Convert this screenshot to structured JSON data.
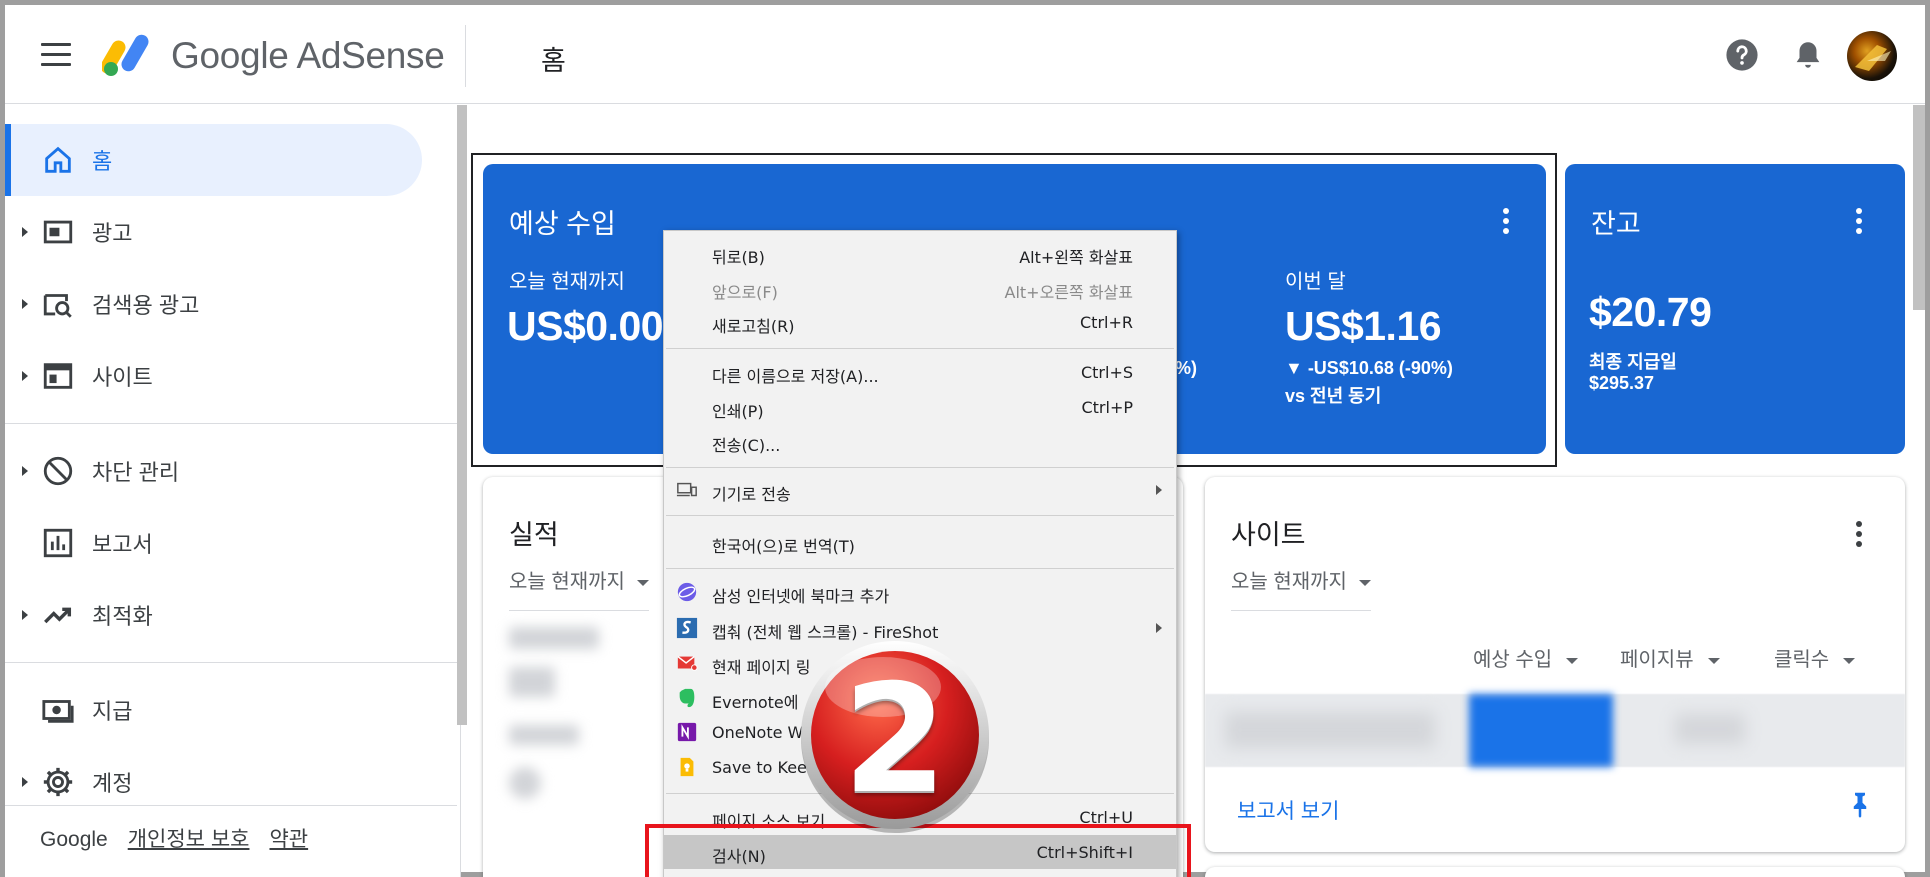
{
  "topbar": {
    "brand": "Google AdSense",
    "page_title": "홈"
  },
  "icons": {
    "menu": "hamburger-menu-icon",
    "help": "help-circle-icon",
    "notifications": "bell-icon",
    "avatar": "user-avatar"
  },
  "sidebar": {
    "items": [
      {
        "label": "홈",
        "icon": "home-icon",
        "active": true
      },
      {
        "label": "광고",
        "icon": "ads-icon"
      },
      {
        "label": "검색용 광고",
        "icon": "search-ads-icon"
      },
      {
        "label": "사이트",
        "icon": "sites-icon"
      },
      {
        "label": "차단 관리",
        "icon": "block-icon"
      },
      {
        "label": "보고서",
        "icon": "reports-icon"
      },
      {
        "label": "최적화",
        "icon": "trending-icon"
      },
      {
        "label": "지급",
        "icon": "payments-icon"
      },
      {
        "label": "계정",
        "icon": "gear-icon"
      }
    ],
    "footer": {
      "brand": "Google",
      "privacy": "개인정보 보호",
      "terms": "약관"
    }
  },
  "earnings_card": {
    "title": "예상 수입",
    "today_label": "오늘 현재까지",
    "today_amount": "US$0.00",
    "partial_pct": "%)",
    "month_label": "이번 달",
    "month_amount": "US$1.16",
    "month_change": "▼ -US$10.68 (-90%)",
    "month_compare": "vs 전년 동기"
  },
  "balance_card": {
    "title": "잔고",
    "amount": "$20.79",
    "last_payment_label": "최종 지급일",
    "last_payment_amount": "$295.37"
  },
  "performance_card": {
    "title": "실적",
    "dropdown": "오늘 현재까지"
  },
  "sites_card": {
    "title": "사이트",
    "dropdown": "오늘 현재까지",
    "columns": [
      "예상 수입",
      "페이지뷰",
      "클릭수"
    ],
    "report_link": "보고서 보기"
  },
  "context_menu": {
    "items": [
      {
        "label": "뒤로(B)",
        "shortcut": "Alt+왼쪽 화살표"
      },
      {
        "label": "앞으로(F)",
        "shortcut": "Alt+오른쪽 화살표",
        "disabled": true
      },
      {
        "label": "새로고침(R)",
        "shortcut": "Ctrl+R"
      },
      {
        "label": "다른 이름으로 저장(A)...",
        "shortcut": "Ctrl+S"
      },
      {
        "label": "인쇄(P)",
        "shortcut": "Ctrl+P"
      },
      {
        "label": "전송(C)...",
        "shortcut": ""
      },
      {
        "label": "기기로 전송",
        "shortcut": "",
        "icon": "devices-icon",
        "submenu": true
      },
      {
        "label": "한국어(으)로 번역(T)",
        "shortcut": ""
      },
      {
        "label": "삼성 인터넷에 북마크 추가",
        "shortcut": "",
        "icon": "samsung-internet-icon"
      },
      {
        "label": "캡춰 (전체 웹 스크롤) - FireShot",
        "shortcut": "",
        "icon": "fireshot-icon",
        "submenu": true
      },
      {
        "label": "현재 페이지 링",
        "shortcut": "",
        "icon": "mail-icon"
      },
      {
        "label": "Evernote에",
        "shortcut": "",
        "icon": "evernote-icon"
      },
      {
        "label": "OneNote W",
        "shortcut": "",
        "icon": "onenote-icon"
      },
      {
        "label": "Save to Kee",
        "shortcut": "",
        "icon": "keep-icon"
      },
      {
        "label": "페이지 소스 보기",
        "shortcut": "Ctrl+U"
      },
      {
        "label": "검사(N)",
        "shortcut": "Ctrl+Shift+I",
        "highlighted": true
      }
    ]
  },
  "badge": {
    "number": "2"
  },
  "colors": {
    "primary_blue": "#1967d2",
    "accent_blue": "#1a73e8",
    "active_nav_bg": "#e8f0fe",
    "highlight_red": "#e8141c",
    "badge_red": "#d61f1f"
  }
}
